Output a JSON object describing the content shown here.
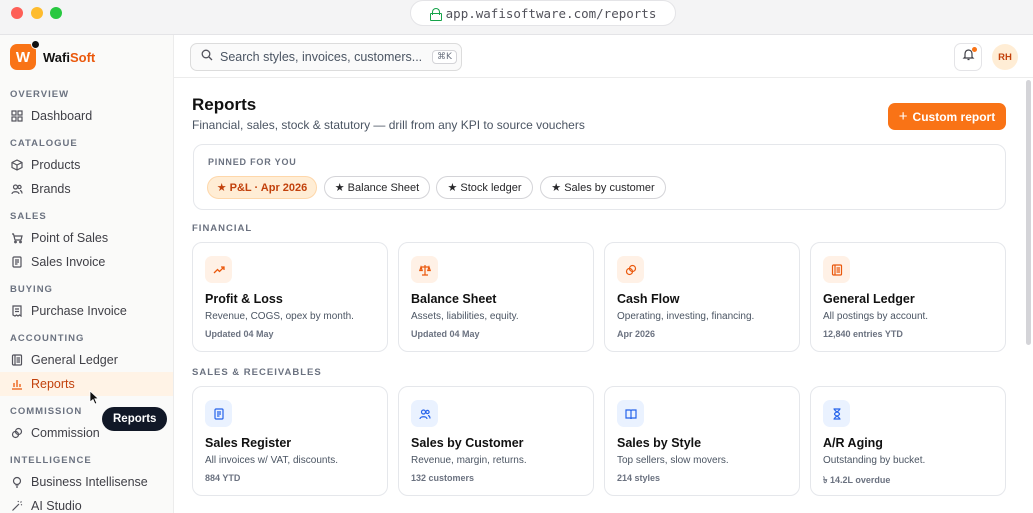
{
  "browser": {
    "url": "app.wafisoftware.com/reports"
  },
  "brand": {
    "logo_letter": "W",
    "name_primary": "Wafi",
    "name_accent": "Soft",
    "accent_color": "#f97316"
  },
  "sidebar": {
    "sections": [
      {
        "label": "OVERVIEW",
        "items": [
          {
            "label": "Dashboard",
            "icon": "grid-icon"
          }
        ]
      },
      {
        "label": "CATALOGUE",
        "items": [
          {
            "label": "Products",
            "icon": "box-icon"
          },
          {
            "label": "Brands",
            "icon": "users-icon"
          }
        ]
      },
      {
        "label": "SALES",
        "items": [
          {
            "label": "Point of Sales",
            "icon": "cart-icon"
          },
          {
            "label": "Sales Invoice",
            "icon": "invoice-icon"
          }
        ]
      },
      {
        "label": "BUYING",
        "items": [
          {
            "label": "Purchase Invoice",
            "icon": "receipt-icon"
          }
        ]
      },
      {
        "label": "ACCOUNTING",
        "items": [
          {
            "label": "General Ledger",
            "icon": "ledger-icon"
          },
          {
            "label": "Reports",
            "icon": "bar-chart-icon",
            "active": true
          }
        ]
      },
      {
        "label": "COMMISSION",
        "items": [
          {
            "label": "Commission",
            "icon": "coins-icon"
          }
        ]
      },
      {
        "label": "INTELLIGENCE",
        "items": [
          {
            "label": "Business Intellisense",
            "icon": "lightbulb-icon"
          },
          {
            "label": "AI Studio",
            "icon": "wand-icon"
          }
        ]
      }
    ],
    "tooltip": "Reports"
  },
  "topbar": {
    "search_placeholder": "Search styles, invoices, customers...",
    "search_shortcut": "⌘K",
    "avatar_initials": "RH"
  },
  "page": {
    "title": "Reports",
    "subtitle": "Financial, sales, stock & statutory — drill from any KPI to source vouchers",
    "cta_label": "Custom report"
  },
  "pinned": {
    "label": "PINNED FOR YOU",
    "chips": [
      "★ P&L · Apr 2026",
      "★ Balance Sheet",
      "★ Stock ledger",
      "★ Sales by customer"
    ]
  },
  "groups": [
    {
      "label": "FINANCIAL",
      "cards": [
        {
          "title": "Profit & Loss",
          "desc": "Revenue, COGS, opex by month.",
          "meta": "Updated 04 May",
          "icon": "trend-up-icon",
          "tone": "orange"
        },
        {
          "title": "Balance Sheet",
          "desc": "Assets, liabilities, equity.",
          "meta": "Updated 04 May",
          "icon": "scale-icon",
          "tone": "orange"
        },
        {
          "title": "Cash Flow",
          "desc": "Operating, investing, financing.",
          "meta": "Apr 2026",
          "icon": "coins-icon",
          "tone": "orange"
        },
        {
          "title": "General Ledger",
          "desc": "All postings by account.",
          "meta": "12,840 entries YTD",
          "icon": "ledger-icon",
          "tone": "orange"
        }
      ]
    },
    {
      "label": "SALES & RECEIVABLES",
      "cards": [
        {
          "title": "Sales Register",
          "desc": "All invoices w/ VAT, discounts.",
          "meta": "884 YTD",
          "icon": "invoice-icon",
          "tone": "blue"
        },
        {
          "title": "Sales by Customer",
          "desc": "Revenue, margin, returns.",
          "meta": "132 customers",
          "icon": "users-icon",
          "tone": "blue"
        },
        {
          "title": "Sales by Style",
          "desc": "Top sellers, slow movers.",
          "meta": "214 styles",
          "icon": "book-icon",
          "tone": "blue"
        },
        {
          "title": "A/R Aging",
          "desc": "Outstanding by bucket.",
          "meta": "৳ 14.2L overdue",
          "icon": "hourglass-icon",
          "tone": "blue"
        }
      ]
    }
  ]
}
